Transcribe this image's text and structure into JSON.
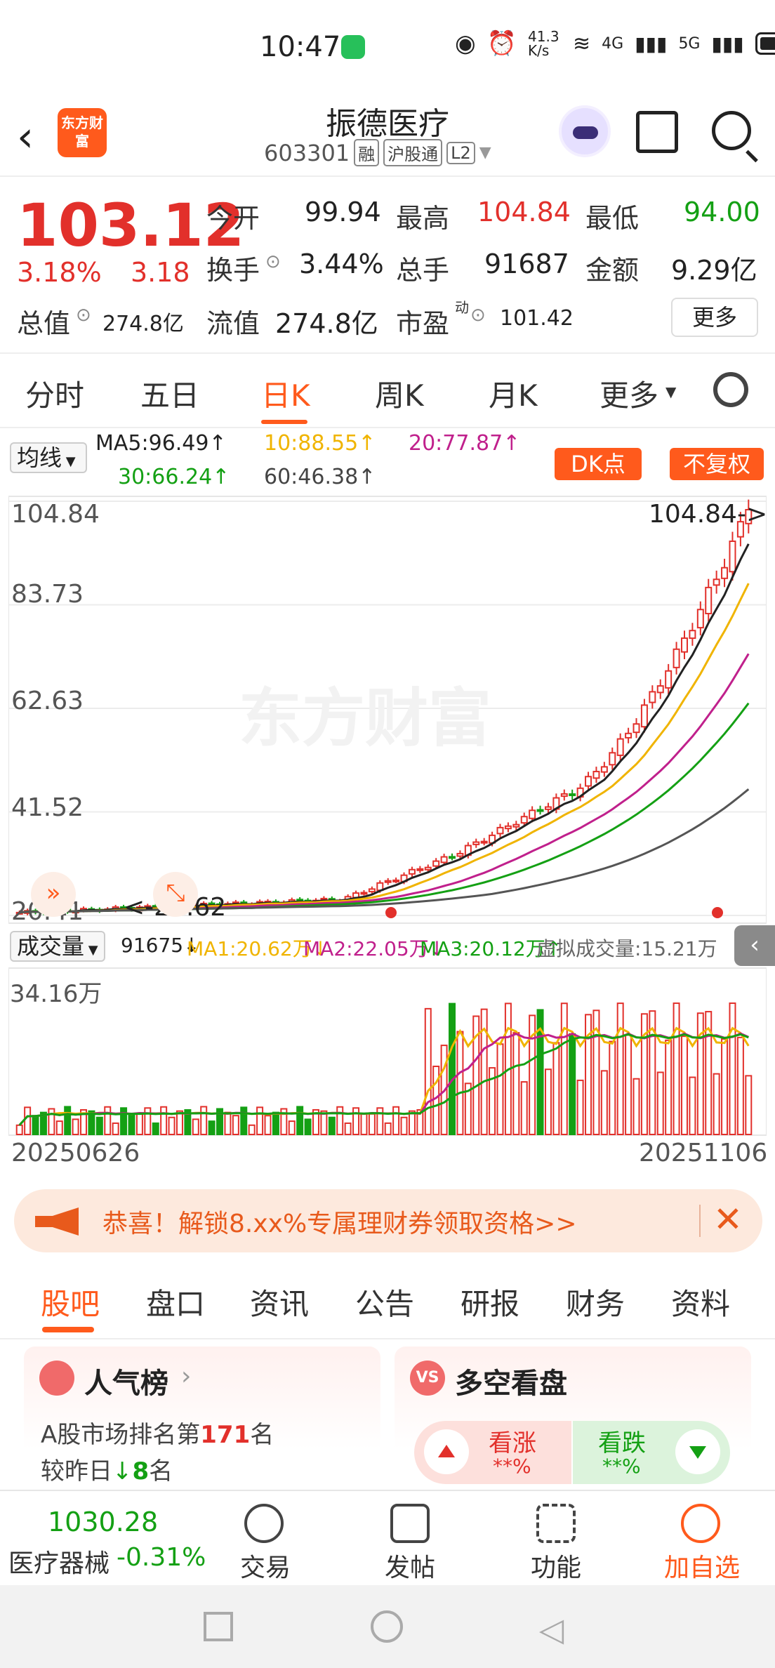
{
  "status": {
    "time": "10:47",
    "net_speed": "41.3 K/s",
    "signal1": "4G",
    "signal2": "5G"
  },
  "header": {
    "back_icon": "‹",
    "logo_text": "东方财富",
    "title": "振德医疗",
    "code": "603301",
    "tags": [
      "融",
      "沪股通",
      "L2"
    ]
  },
  "quote": {
    "price": "103.12",
    "change_pct": "3.18%",
    "change": "3.18",
    "open_label": "今开",
    "open": "99.94",
    "high_label": "最高",
    "high": "104.84",
    "low_label": "最低",
    "low": "94.00",
    "turnover_label": "换手",
    "turnover": "3.44%",
    "volume_label": "总手",
    "volume": "91687",
    "amount_label": "金额",
    "amount": "9.29亿",
    "mktcap_label": "总值",
    "mktcap": "274.8亿",
    "float_label": "流值",
    "float_cap": "274.8亿",
    "pe_label": "市盈",
    "pe_sup": "动",
    "pe": "101.42",
    "more_label": "更多"
  },
  "period_tabs": [
    "分时",
    "五日",
    "日K",
    "周K",
    "月K",
    "更多"
  ],
  "ma_legend": {
    "button": "均线",
    "ma5": "MA5:96.49↑",
    "ma10": "10:88.55↑",
    "ma20": "20:77.87↑",
    "ma30": "30:66.24↑",
    "ma60": "60:46.38↑",
    "dk_button": "DK点",
    "fq_button": "不复权",
    "colors": {
      "ma5": "#222222",
      "ma10": "#f0b400",
      "ma20": "#c0208c",
      "ma30": "#14a014",
      "ma60": "#555555"
    }
  },
  "kchart": {
    "y_labels": [
      "104.84",
      "83.73",
      "62.63",
      "41.52",
      "20.41"
    ],
    "max_label": "104.84->",
    "min_label": "<-20.62",
    "watermark": "东方财富"
  },
  "volume": {
    "selector": "成交量",
    "current": "91675↓",
    "ma1": "MA1:20.62万↓",
    "ma2": "MA2:22.05万↓",
    "ma3": "MA3:20.12万↑",
    "virtual": "虚拟成交量:15.21万",
    "top_label": "34.16万",
    "date_start": "20250626",
    "date_end": "20251106"
  },
  "chart_data": {
    "type": "candlestick",
    "ylim": [
      20.41,
      104.84
    ],
    "x_range": [
      "20250626",
      "20251106"
    ],
    "high": 104.84,
    "low": 20.62,
    "ma": {
      "MA5": 96.49,
      "MA10": 88.55,
      "MA20": 77.87,
      "MA30": 66.24,
      "MA60": 46.38
    }
  },
  "promo": {
    "text": "恭喜！解锁8.xx%专属理财券领取资格>>",
    "close": "✕"
  },
  "info_tabs": [
    "股吧",
    "盘口",
    "资讯",
    "公告",
    "研报",
    "财务",
    "资料"
  ],
  "cards": {
    "popularity": {
      "title": "人气榜",
      "line1_pre": "A股市场排名第",
      "rank": "171",
      "line1_post": "名",
      "line2_pre": "较昨日",
      "change": "8",
      "line2_post": "名"
    },
    "sentiment": {
      "title": "多空看盘",
      "bull": "看涨",
      "bull_val": "**%",
      "bear": "看跌",
      "bear_val": "**%"
    }
  },
  "bottom_nav": {
    "index_value": "1030.28",
    "index_name": "医疗器械",
    "index_change": "-0.31%",
    "trade": "交易",
    "post": "发帖",
    "func": "功能",
    "add": "加自选"
  }
}
